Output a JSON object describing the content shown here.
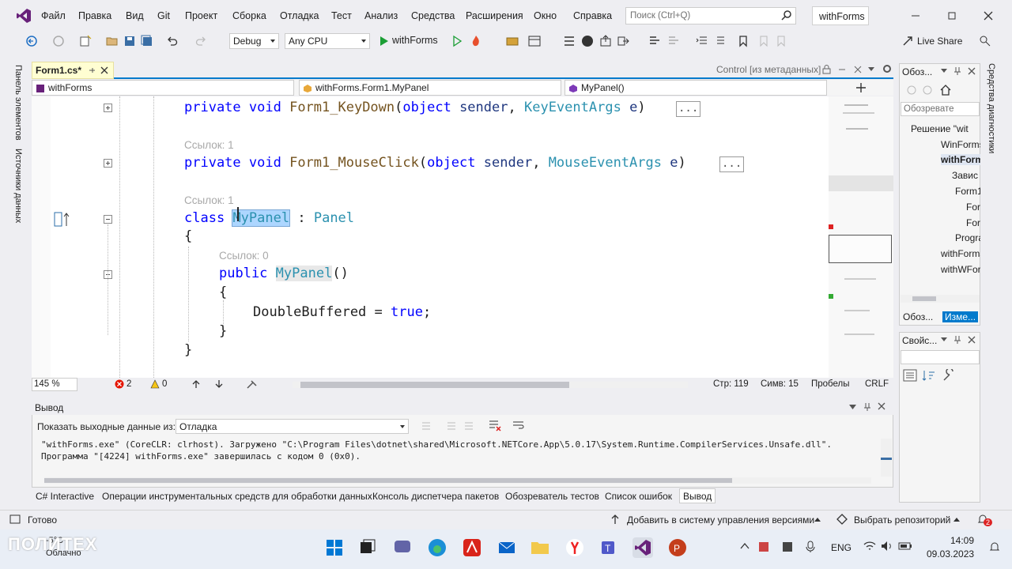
{
  "menu": {
    "items": [
      "Файл",
      "Правка",
      "Вид",
      "Git",
      "Проект",
      "Сборка",
      "Отладка",
      "Тест",
      "Анализ",
      "Средства",
      "Расширения",
      "Окно",
      "Справка"
    ],
    "search_placeholder": "Поиск (Ctrl+Q)",
    "solution_name": "withForms"
  },
  "toolbar": {
    "config": "Debug",
    "platform": "Any CPU",
    "run_target": "withForms",
    "live_share": "Live Share"
  },
  "side": {
    "left_top": "Панель элементов",
    "left_bottom": "Источники данных",
    "right": "Средства диагностики"
  },
  "editor": {
    "tab_title": "Form1.cs*",
    "metadata_tab": "Control [из метаданных]",
    "nav_project": "withForms",
    "nav_class": "withForms.Form1.MyPanel",
    "nav_member": "MyPanel()",
    "refs_1": "Ссылок: 1",
    "refs_2": "Ссылок: 1",
    "refs_0": "Ссылок: 0",
    "collapsed": "...",
    "line1": {
      "kw": "private void",
      "method": "Form1_KeyDown",
      "open": "(",
      "kw2": "object",
      "param": "sender",
      "comma": ",",
      "type": "KeyEventArgs",
      "param2": "e",
      "close": ")"
    },
    "line2": {
      "kw": "private void",
      "method": "Form1_MouseClick",
      "open": "(",
      "kw2": "object",
      "param": "sender",
      "comma": ",",
      "type": "MouseEventArgs",
      "param2": "e",
      "close": ")"
    },
    "line3": {
      "kw": "class",
      "name": "MyPanel",
      "colon": ":",
      "base": "Panel"
    },
    "brace_open": "{",
    "brace_close": "}",
    "ctor": {
      "kw": "public",
      "name": "MyPanel",
      "parens": "()"
    },
    "body": {
      "prop": "DoubleBuffered",
      "eq": "=",
      "val": "true",
      "semi": ";"
    }
  },
  "editor_status": {
    "zoom": "145 %",
    "errors": "2",
    "warnings": "0",
    "line": "Стр: 119",
    "col": "Симв: 15",
    "ws": "Пробелы",
    "eol": "CRLF"
  },
  "output": {
    "title": "Вывод",
    "show_label": "Показать выходные данные из:",
    "source": "Отладка",
    "line1": "\"withForms.exe\" (CoreCLR: clrhost). Загружено \"C:\\Program Files\\dotnet\\shared\\Microsoft.NETCore.App\\5.0.17\\System.Runtime.CompilerServices.Unsafe.dll\".",
    "line2": "Программа \"[4224] withForms.exe\" завершилась с кодом 0 (0x0)."
  },
  "bottom_tabs": [
    "C# Interactive",
    "Операции инструментальных средств для обработки данных",
    "Консоль диспетчера пакетов",
    "Обозреватель тестов",
    "Список ошибок",
    "Вывод"
  ],
  "solution": {
    "title": "Обоз...",
    "search": "Обозревате",
    "items": [
      "Решение \"wit",
      "WinForms",
      "withForm",
      "Завис",
      "Form1",
      "For",
      "For",
      "Progra",
      "withForms",
      "withWFor"
    ],
    "tab1": "Обоз...",
    "tab2": "Изме..."
  },
  "properties": {
    "title": "Свойс..."
  },
  "statusbar": {
    "ready": "Готово",
    "vcs": "Добавить в систему управления версиями",
    "repo": "Выбрать репозиторий",
    "notif": "2"
  },
  "taskbar": {
    "weather": "-5°C",
    "weather_desc": "Облачно",
    "lang": "ENG",
    "time": "14:09",
    "date": "09.03.2023",
    "watermark": "ПОЛИТЕХ"
  },
  "colors": {
    "accent": "#007acc",
    "vs_purple": "#68217a",
    "keyword": "#0000ff",
    "type": "#2b91af"
  }
}
